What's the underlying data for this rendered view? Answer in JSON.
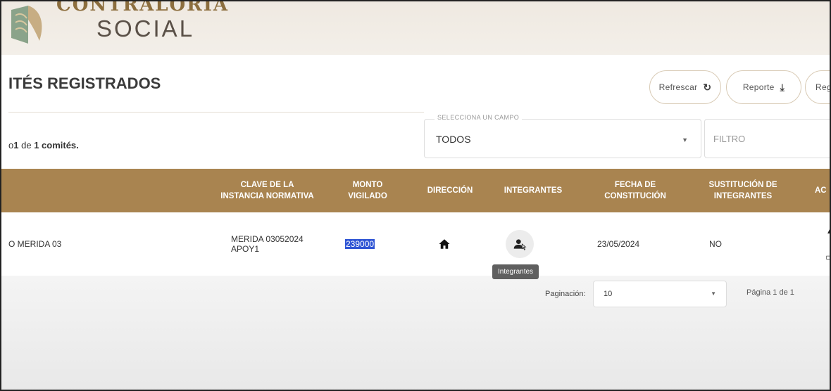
{
  "header": {
    "logo_top": "CONTRALORIA",
    "logo_bottom": "SOCIAL"
  },
  "page": {
    "title": "ITÉS REGISTRADOS",
    "count_prefix": "o",
    "count_num": "1",
    "count_mid": "de",
    "count_total": "1 comités."
  },
  "toolbar": {
    "refresh_label": "Refrescar",
    "report_label": "Reporte",
    "register_label": "Regi"
  },
  "filters": {
    "field_legend": "SELECCIONA UN CAMPO",
    "field_value": "TODOS",
    "filter_placeholder": "FILTRO"
  },
  "table": {
    "headers": [
      "CLAVE DE LA INSTANCIA NORMATIVA",
      "MONTO VIGILADO",
      "DIRECCIÓN",
      "INTEGRANTES",
      "FECHA DE CONSTITUCIÓN",
      "SUSTITUCIÓN DE INTEGRANTES",
      "AC"
    ],
    "row": {
      "name": "O MERIDA 03",
      "clave": "MERIDA 03052024 APOY1",
      "monto": "239000",
      "fecha": "23/05/2024",
      "sustitucion": "NO"
    }
  },
  "tooltip": "Integrantes",
  "pagination": {
    "label": "Paginación:",
    "value": "10",
    "page_text": "Página 1 de 1"
  },
  "colors": {
    "table_header": "#a98450",
    "selection": "#2f55d4"
  }
}
